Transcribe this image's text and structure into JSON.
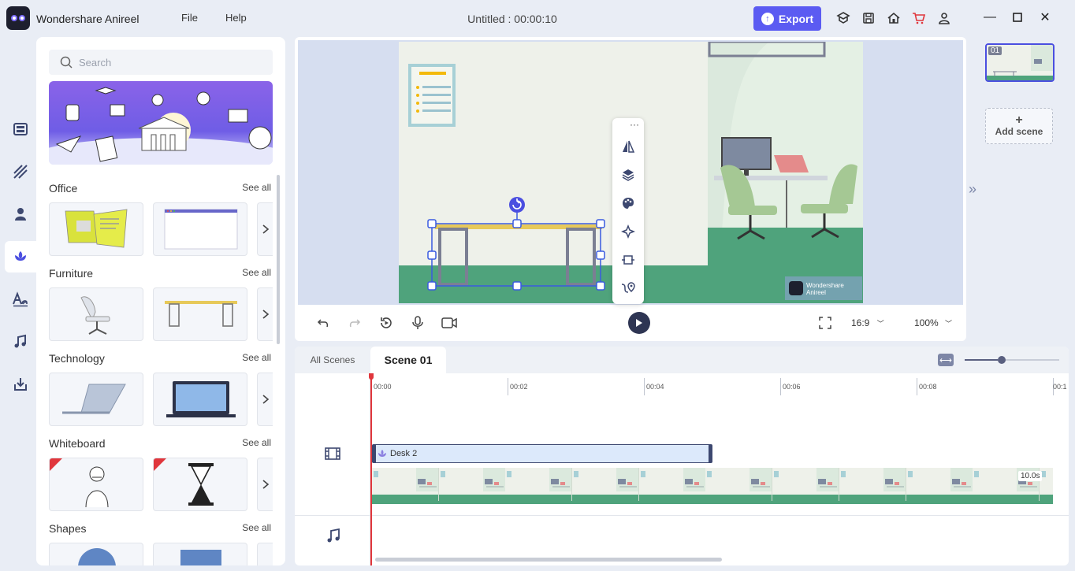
{
  "app": {
    "name": "Wondershare Anireel",
    "menu": [
      "File",
      "Help"
    ],
    "document_title": "Untitled : 00:00:10",
    "export_label": "Export"
  },
  "assets": {
    "search_placeholder": "Search",
    "see_all": "See all",
    "categories": [
      {
        "title": "Office"
      },
      {
        "title": "Furniture"
      },
      {
        "title": "Technology"
      },
      {
        "title": "Whiteboard"
      },
      {
        "title": "Shapes"
      }
    ]
  },
  "canvas": {
    "aspect_ratio": "16:9",
    "zoom": "100%",
    "watermark": "Wondershare Anireel"
  },
  "scenes": {
    "thumb_label": "01",
    "add_label": "Add scene"
  },
  "timeline": {
    "tabs": [
      "All Scenes",
      "Scene 01"
    ],
    "ruler": [
      "00:00",
      "00:02",
      "00:04",
      "00:06",
      "00:08",
      "00:1"
    ],
    "clip_label": "Desk 2",
    "duration": "10.0s"
  },
  "colors": {
    "accent": "#5b5bf2",
    "playhead": "#e0363c",
    "selection": "#3a5be0"
  }
}
